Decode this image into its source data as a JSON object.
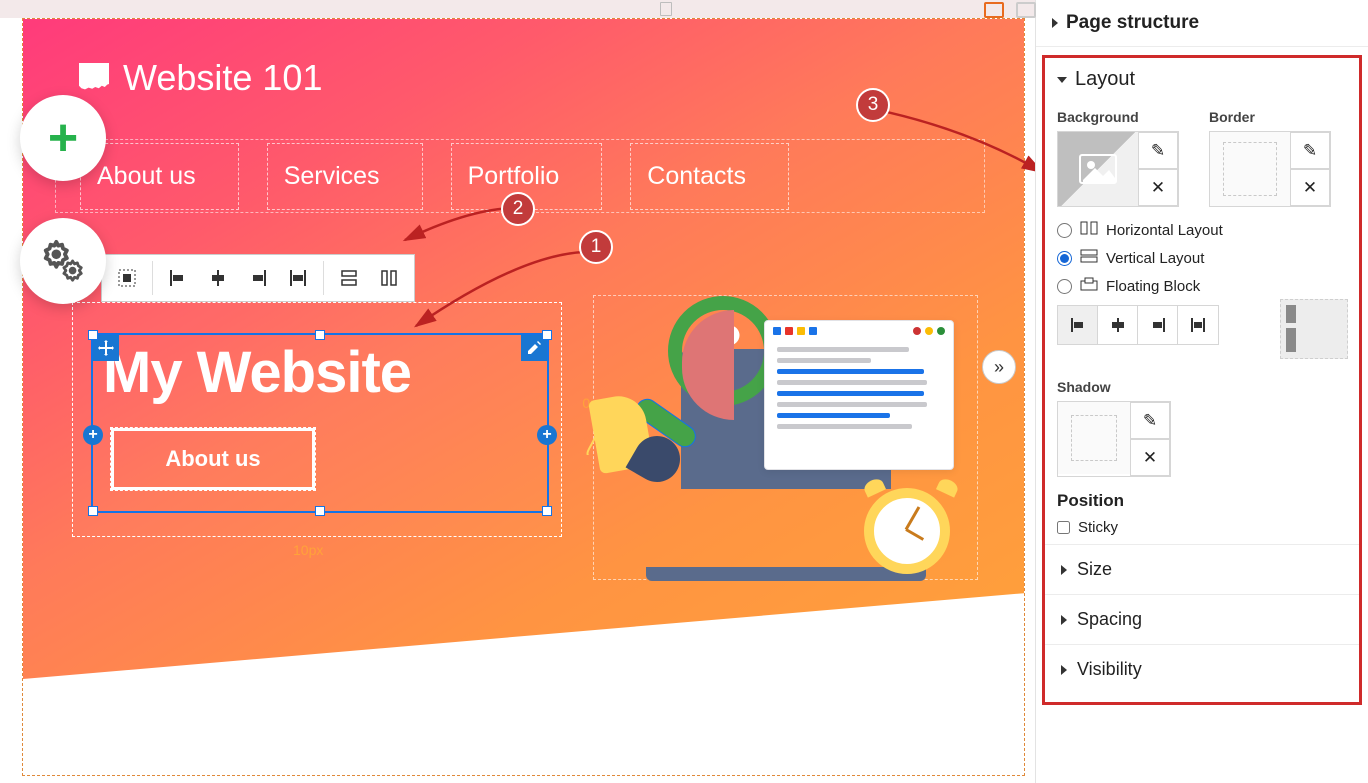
{
  "site": {
    "title": "Website 101",
    "nav": [
      "About us",
      "Services",
      "Portfolio",
      "Contacts"
    ]
  },
  "selected": {
    "heading": "My Website",
    "button_label": "About us",
    "size_right": "0px",
    "size_bottom": "10px"
  },
  "annotations": {
    "b1": "1",
    "b2": "2",
    "b3": "3"
  },
  "sidebar": {
    "page_structure": "Page structure",
    "layout": {
      "title": "Layout",
      "background_label": "Background",
      "border_label": "Border",
      "radios": {
        "horizontal": "Horizontal Layout",
        "vertical": "Vertical Layout",
        "floating": "Floating Block"
      },
      "shadow_label": "Shadow",
      "position_label": "Position",
      "sticky_label": "Sticky"
    },
    "panels": {
      "size": "Size",
      "spacing": "Spacing",
      "visibility": "Visibility"
    }
  }
}
